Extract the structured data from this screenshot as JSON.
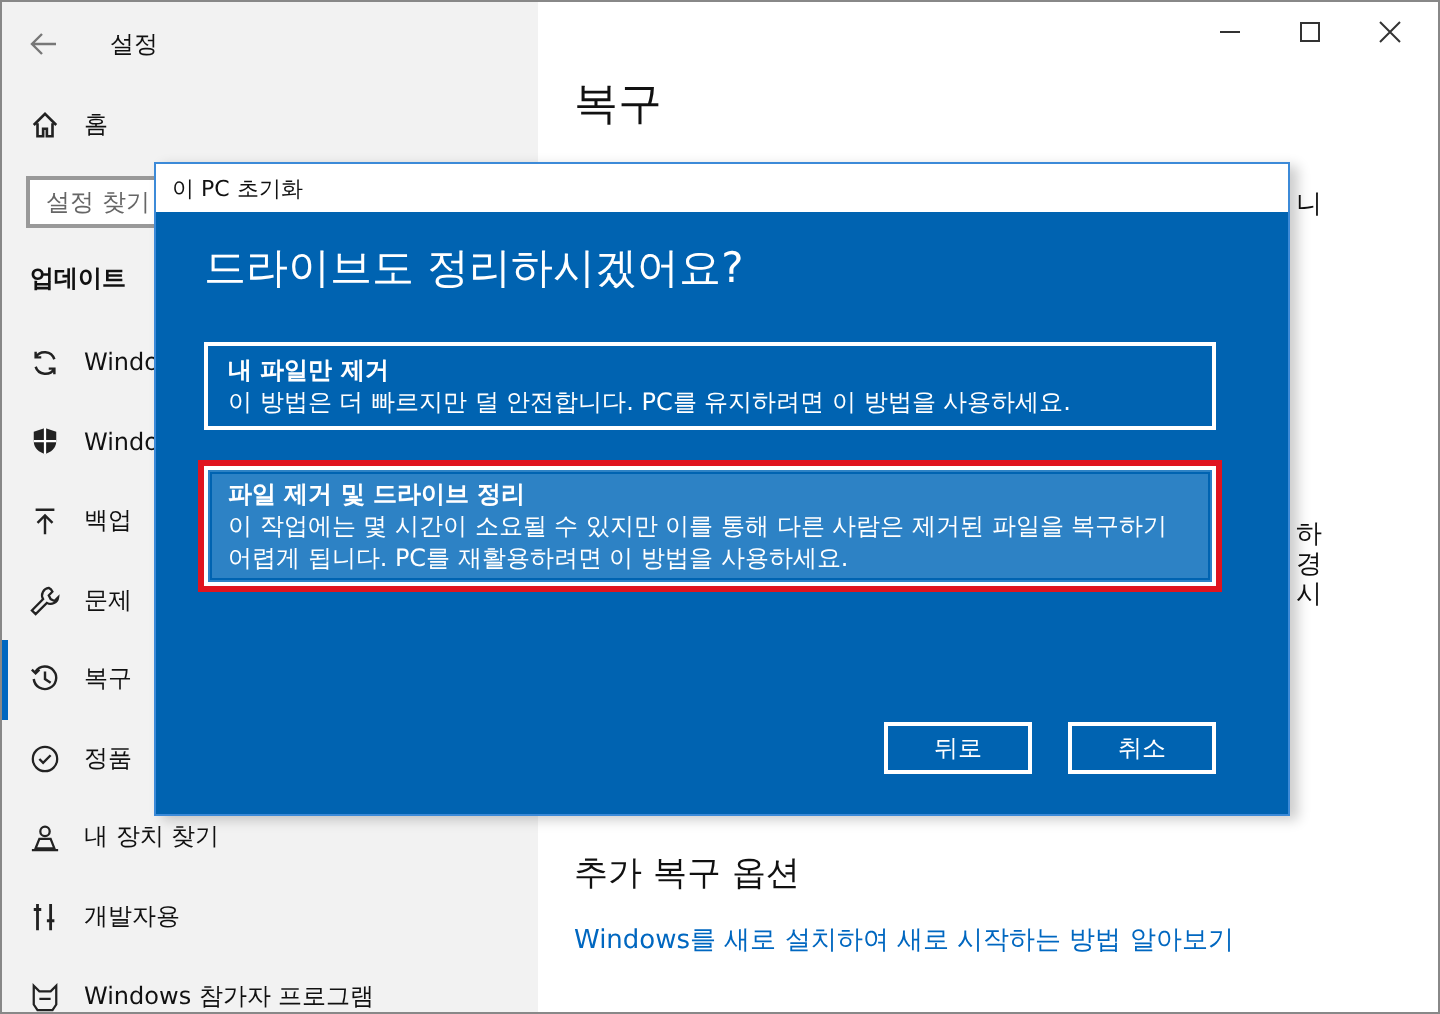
{
  "window": {
    "title": "설정"
  },
  "sidebar": {
    "home": "홈",
    "search": {
      "placeholder": "설정 찾기"
    },
    "section": "업데이트",
    "items": [
      {
        "label": "Windo",
        "selected": false
      },
      {
        "label": "Windo",
        "selected": false
      },
      {
        "label": "백업",
        "selected": false
      },
      {
        "label": "문제",
        "selected": false
      },
      {
        "label": "복구",
        "selected": true
      },
      {
        "label": "정품",
        "selected": false
      },
      {
        "label": "내 장치 찾기",
        "selected": false
      },
      {
        "label": "개발자용",
        "selected": false
      },
      {
        "label": "Windows 참가자 프로그램",
        "selected": false
      }
    ]
  },
  "content": {
    "title": "복구",
    "fragments_top": [
      "니"
    ],
    "fragments_mid": [
      "하",
      "경",
      "시"
    ],
    "section": "추가 복구 옵션",
    "link": "Windows를 새로 설치하여 새로 시작하는 방법 알아보기"
  },
  "dialog": {
    "title": "이 PC 초기화",
    "heading": "드라이브도 정리하시겠어요?",
    "options": [
      {
        "title": "내 파일만 제거",
        "description": "이 방법은 더 빠르지만 덜 안전합니다. PC를 유지하려면 이 방법을 사용하세요.",
        "selected": false,
        "annotated": false
      },
      {
        "title": "파일 제거 및 드라이브 정리",
        "description": "이 작업에는 몇 시간이 소요될 수 있지만 이를 통해 다른 사람은 제거된 파일을 복구하기 어렵게 됩니다. PC를 재활용하려면 이 방법을 사용하세요.",
        "selected": true,
        "annotated": true
      }
    ],
    "buttons": [
      "뒤로",
      "취소"
    ]
  }
}
